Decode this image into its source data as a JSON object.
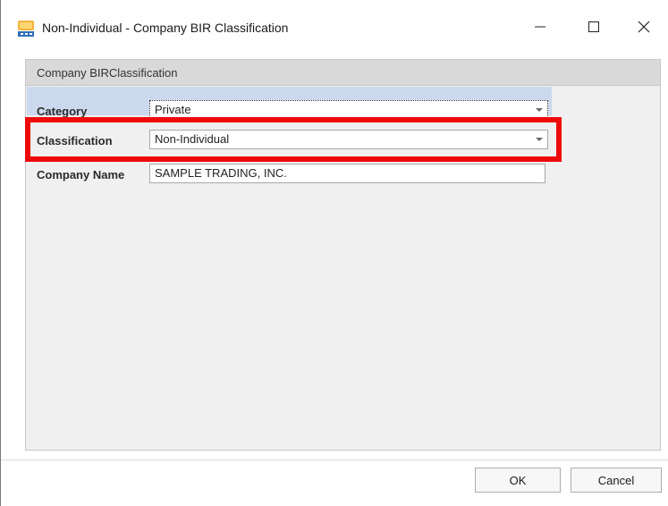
{
  "window": {
    "title": "Non-Individual - Company BIR Classification",
    "app_icon": "bir-app-icon",
    "controls": {
      "minimize_icon": "minimize-icon",
      "maximize_icon": "maximize-icon",
      "close_icon": "close-icon"
    }
  },
  "panel": {
    "header": "Company BIRClassification"
  },
  "form": {
    "category": {
      "label": "Category",
      "value": "Private"
    },
    "classification": {
      "label": "Classification",
      "value": "Non-Individual"
    },
    "company_name": {
      "label": "Company Name",
      "value": "SAMPLE TRADING, INC."
    }
  },
  "buttons": {
    "ok_label": "OK",
    "cancel_label": "Cancel"
  },
  "colors": {
    "highlight_row": "#ccd8ee",
    "annotation_red": "#ee0a0a",
    "panel_header": "#d9d9d9"
  }
}
